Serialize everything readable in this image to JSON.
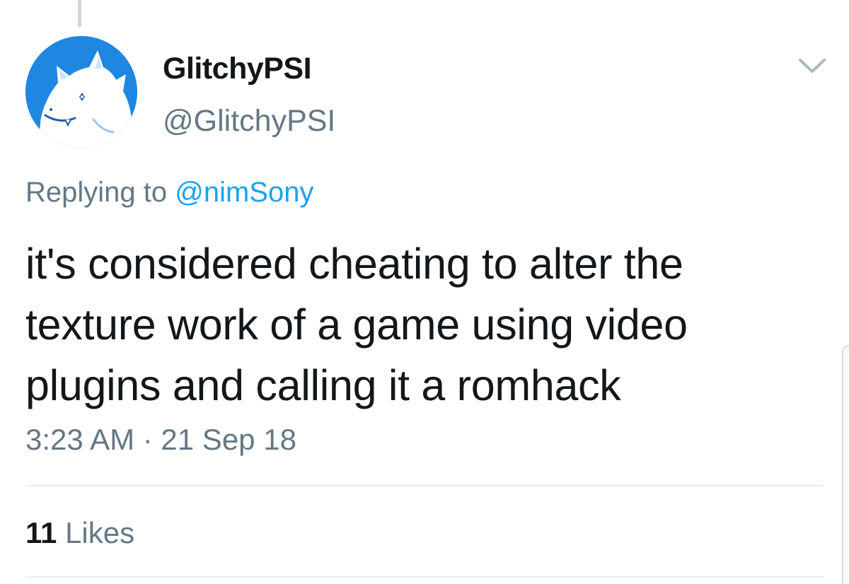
{
  "tweet": {
    "display_name": "GlitchyPSI",
    "handle": "@GlitchyPSI",
    "reply_prefix": "Replying to ",
    "reply_to": "@nimSony",
    "text": "it's considered cheating to alter the texture work of a game using video plugins and calling it a romhack",
    "timestamp": "3:23 AM · 21 Sep 18",
    "likes_count": "11",
    "likes_label": "Likes"
  },
  "icons": {
    "avatar": "avatar-cartoon-creature",
    "menu": "chevron-down-icon"
  },
  "colors": {
    "text_primary": "#14171a",
    "text_secondary": "#657786",
    "link": "#1da1f2",
    "avatar_bg": "#1f86e2",
    "divider": "#e6ecf0"
  }
}
